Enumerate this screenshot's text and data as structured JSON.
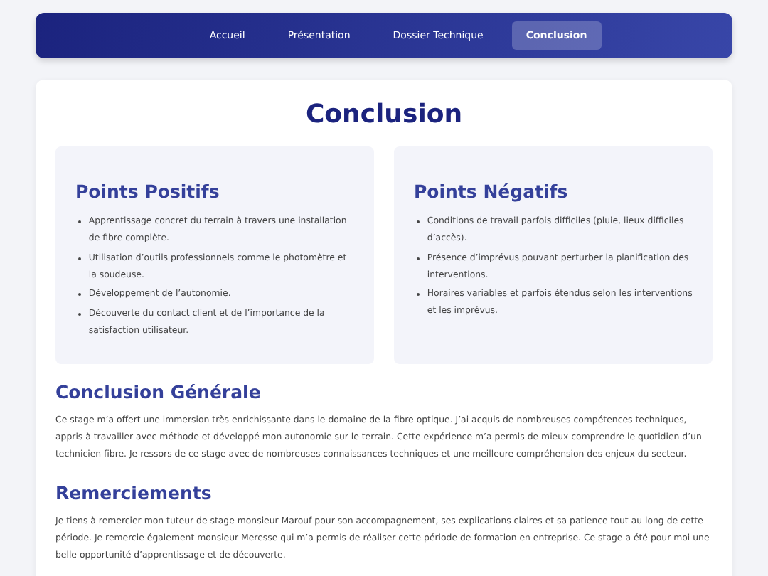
{
  "nav": {
    "items": [
      {
        "label": "Accueil",
        "selected": false
      },
      {
        "label": "Présentation",
        "selected": false
      },
      {
        "label": "Dossier Technique",
        "selected": false
      },
      {
        "label": "Conclusion",
        "selected": true
      }
    ]
  },
  "page_title": "Conclusion",
  "columns": [
    {
      "title": "Points Positifs",
      "items": [
        "Apprentissage concret du terrain à travers une installation de fibre complète.",
        "Utilisation d’outils professionnels comme le photomètre et la soudeuse.",
        "Développement de l’autonomie.",
        "Découverte du contact client et de l’importance de la satisfaction utilisateur."
      ]
    },
    {
      "title": "Points Négatifs",
      "items": [
        "Conditions de travail parfois difficiles (pluie, lieux difficiles d’accès).",
        "Présence d’imprévus pouvant perturber la planification des interventions.",
        "Horaires variables et parfois étendus selon les interventions et les imprévus."
      ]
    }
  ],
  "sections": [
    {
      "title": "Conclusion Générale",
      "text": "Ce stage m’a offert une immersion très enrichissante dans le domaine de la fibre optique. J’ai acquis de nombreuses compétences techniques, appris à travailler avec méthode et développé mon autonomie sur le terrain. Cette expérience m’a permis de mieux comprendre le quotidien d’un technicien fibre. Je ressors de ce stage avec de nombreuses connaissances techniques et une meilleure compréhension des enjeux du secteur."
    },
    {
      "title": "Remerciements",
      "text": "Je tiens à remercier mon tuteur de stage monsieur Marouf pour son accompagnement, ses explications claires et sa patience tout au long de cette période. Je remercie également monsieur Meresse qui m’a permis de réaliser cette période de formation en entreprise. Ce stage a été pour moi une belle opportunité d’apprentissage et de découverte."
    }
  ]
}
